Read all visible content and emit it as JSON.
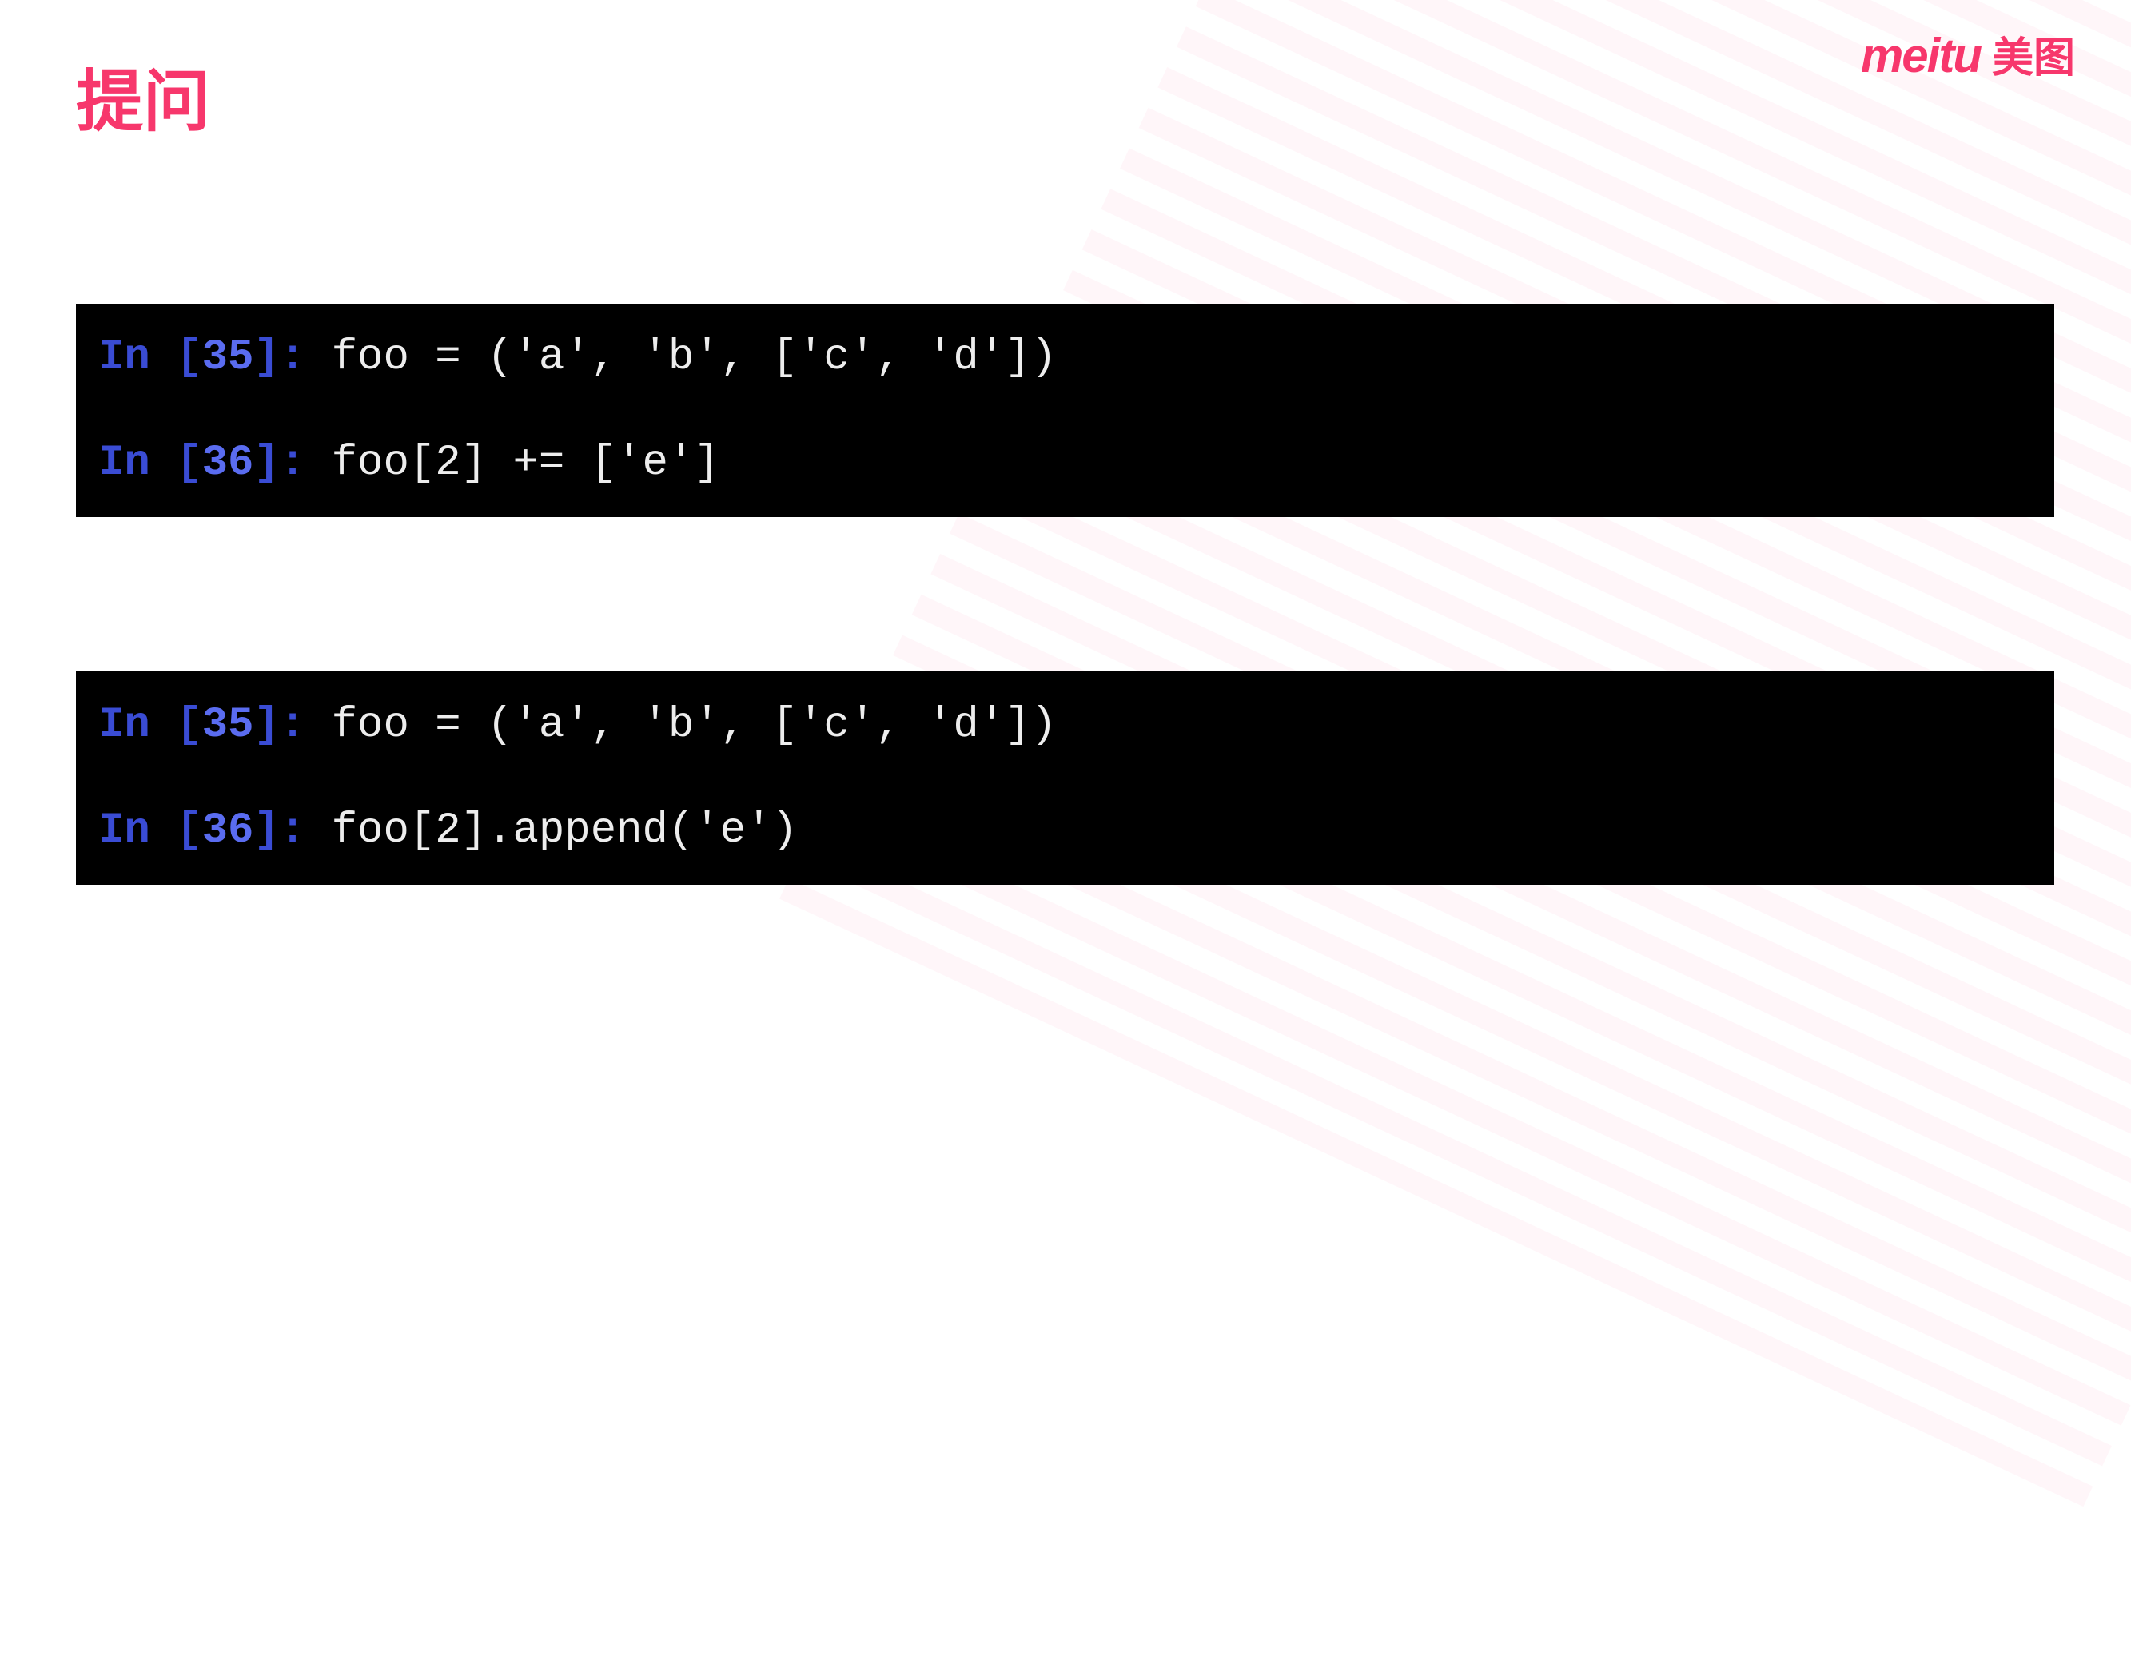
{
  "slide": {
    "title": "提问"
  },
  "brand": {
    "name_en": "meitu",
    "name_cn": "美图"
  },
  "blocks": [
    {
      "lines": [
        {
          "prompt_prefix": "In [",
          "prompt_num": "35",
          "prompt_suffix": "]: ",
          "code": "foo = ('a', 'b', ['c', 'd'])"
        },
        {
          "prompt_prefix": "In [",
          "prompt_num": "36",
          "prompt_suffix": "]: ",
          "code": "foo[2] += ['e']"
        }
      ]
    },
    {
      "lines": [
        {
          "prompt_prefix": "In [",
          "prompt_num": "35",
          "prompt_suffix": "]: ",
          "code": "foo = ('a', 'b', ['c', 'd'])"
        },
        {
          "prompt_prefix": "In [",
          "prompt_num": "36",
          "prompt_suffix": "]: ",
          "code": "foo[2].append('e')"
        }
      ]
    }
  ]
}
